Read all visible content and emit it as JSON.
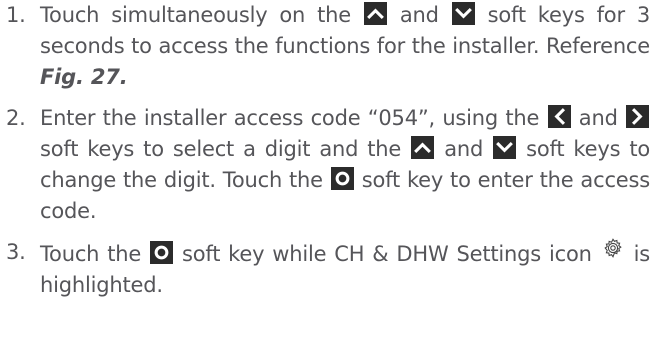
{
  "steps": [
    {
      "number": "1.",
      "segments": [
        {
          "type": "text",
          "value": "Touch simultaneously on the "
        },
        {
          "type": "icon",
          "icon": "up-arrow-key-icon"
        },
        {
          "type": "text",
          "value": " and "
        },
        {
          "type": "icon",
          "icon": "down-arrow-key-icon"
        },
        {
          "type": "text",
          "value": " soft keys for 3 seconds to access the functions for the installer. Reference "
        },
        {
          "type": "figref",
          "value": "Fig. 27."
        }
      ]
    },
    {
      "number": "2.",
      "segments": [
        {
          "type": "text",
          "value": "Enter the installer access code “054”, using the "
        },
        {
          "type": "icon",
          "icon": "left-arrow-key-icon"
        },
        {
          "type": "text",
          "value": " and "
        },
        {
          "type": "icon",
          "icon": "right-arrow-key-icon"
        },
        {
          "type": "text",
          "value": " soft keys to select a digit and the "
        },
        {
          "type": "icon",
          "icon": "up-arrow-key-icon"
        },
        {
          "type": "text",
          "value": " and "
        },
        {
          "type": "icon",
          "icon": "down-arrow-key-icon"
        },
        {
          "type": "text",
          "value": " soft keys to change the digit. Touch the "
        },
        {
          "type": "icon",
          "icon": "ok-key-icon"
        },
        {
          "type": "text",
          "value": " soft key to enter the access code."
        }
      ]
    },
    {
      "number": "3.",
      "segments": [
        {
          "type": "text",
          "value": "Touch the "
        },
        {
          "type": "icon",
          "icon": "ok-key-icon"
        },
        {
          "type": "text",
          "value": " soft key while CH & DHW Settings icon "
        },
        {
          "type": "icon",
          "icon": "settings-gear-icon"
        },
        {
          "type": "text",
          "value": " is highlighted."
        }
      ]
    }
  ]
}
